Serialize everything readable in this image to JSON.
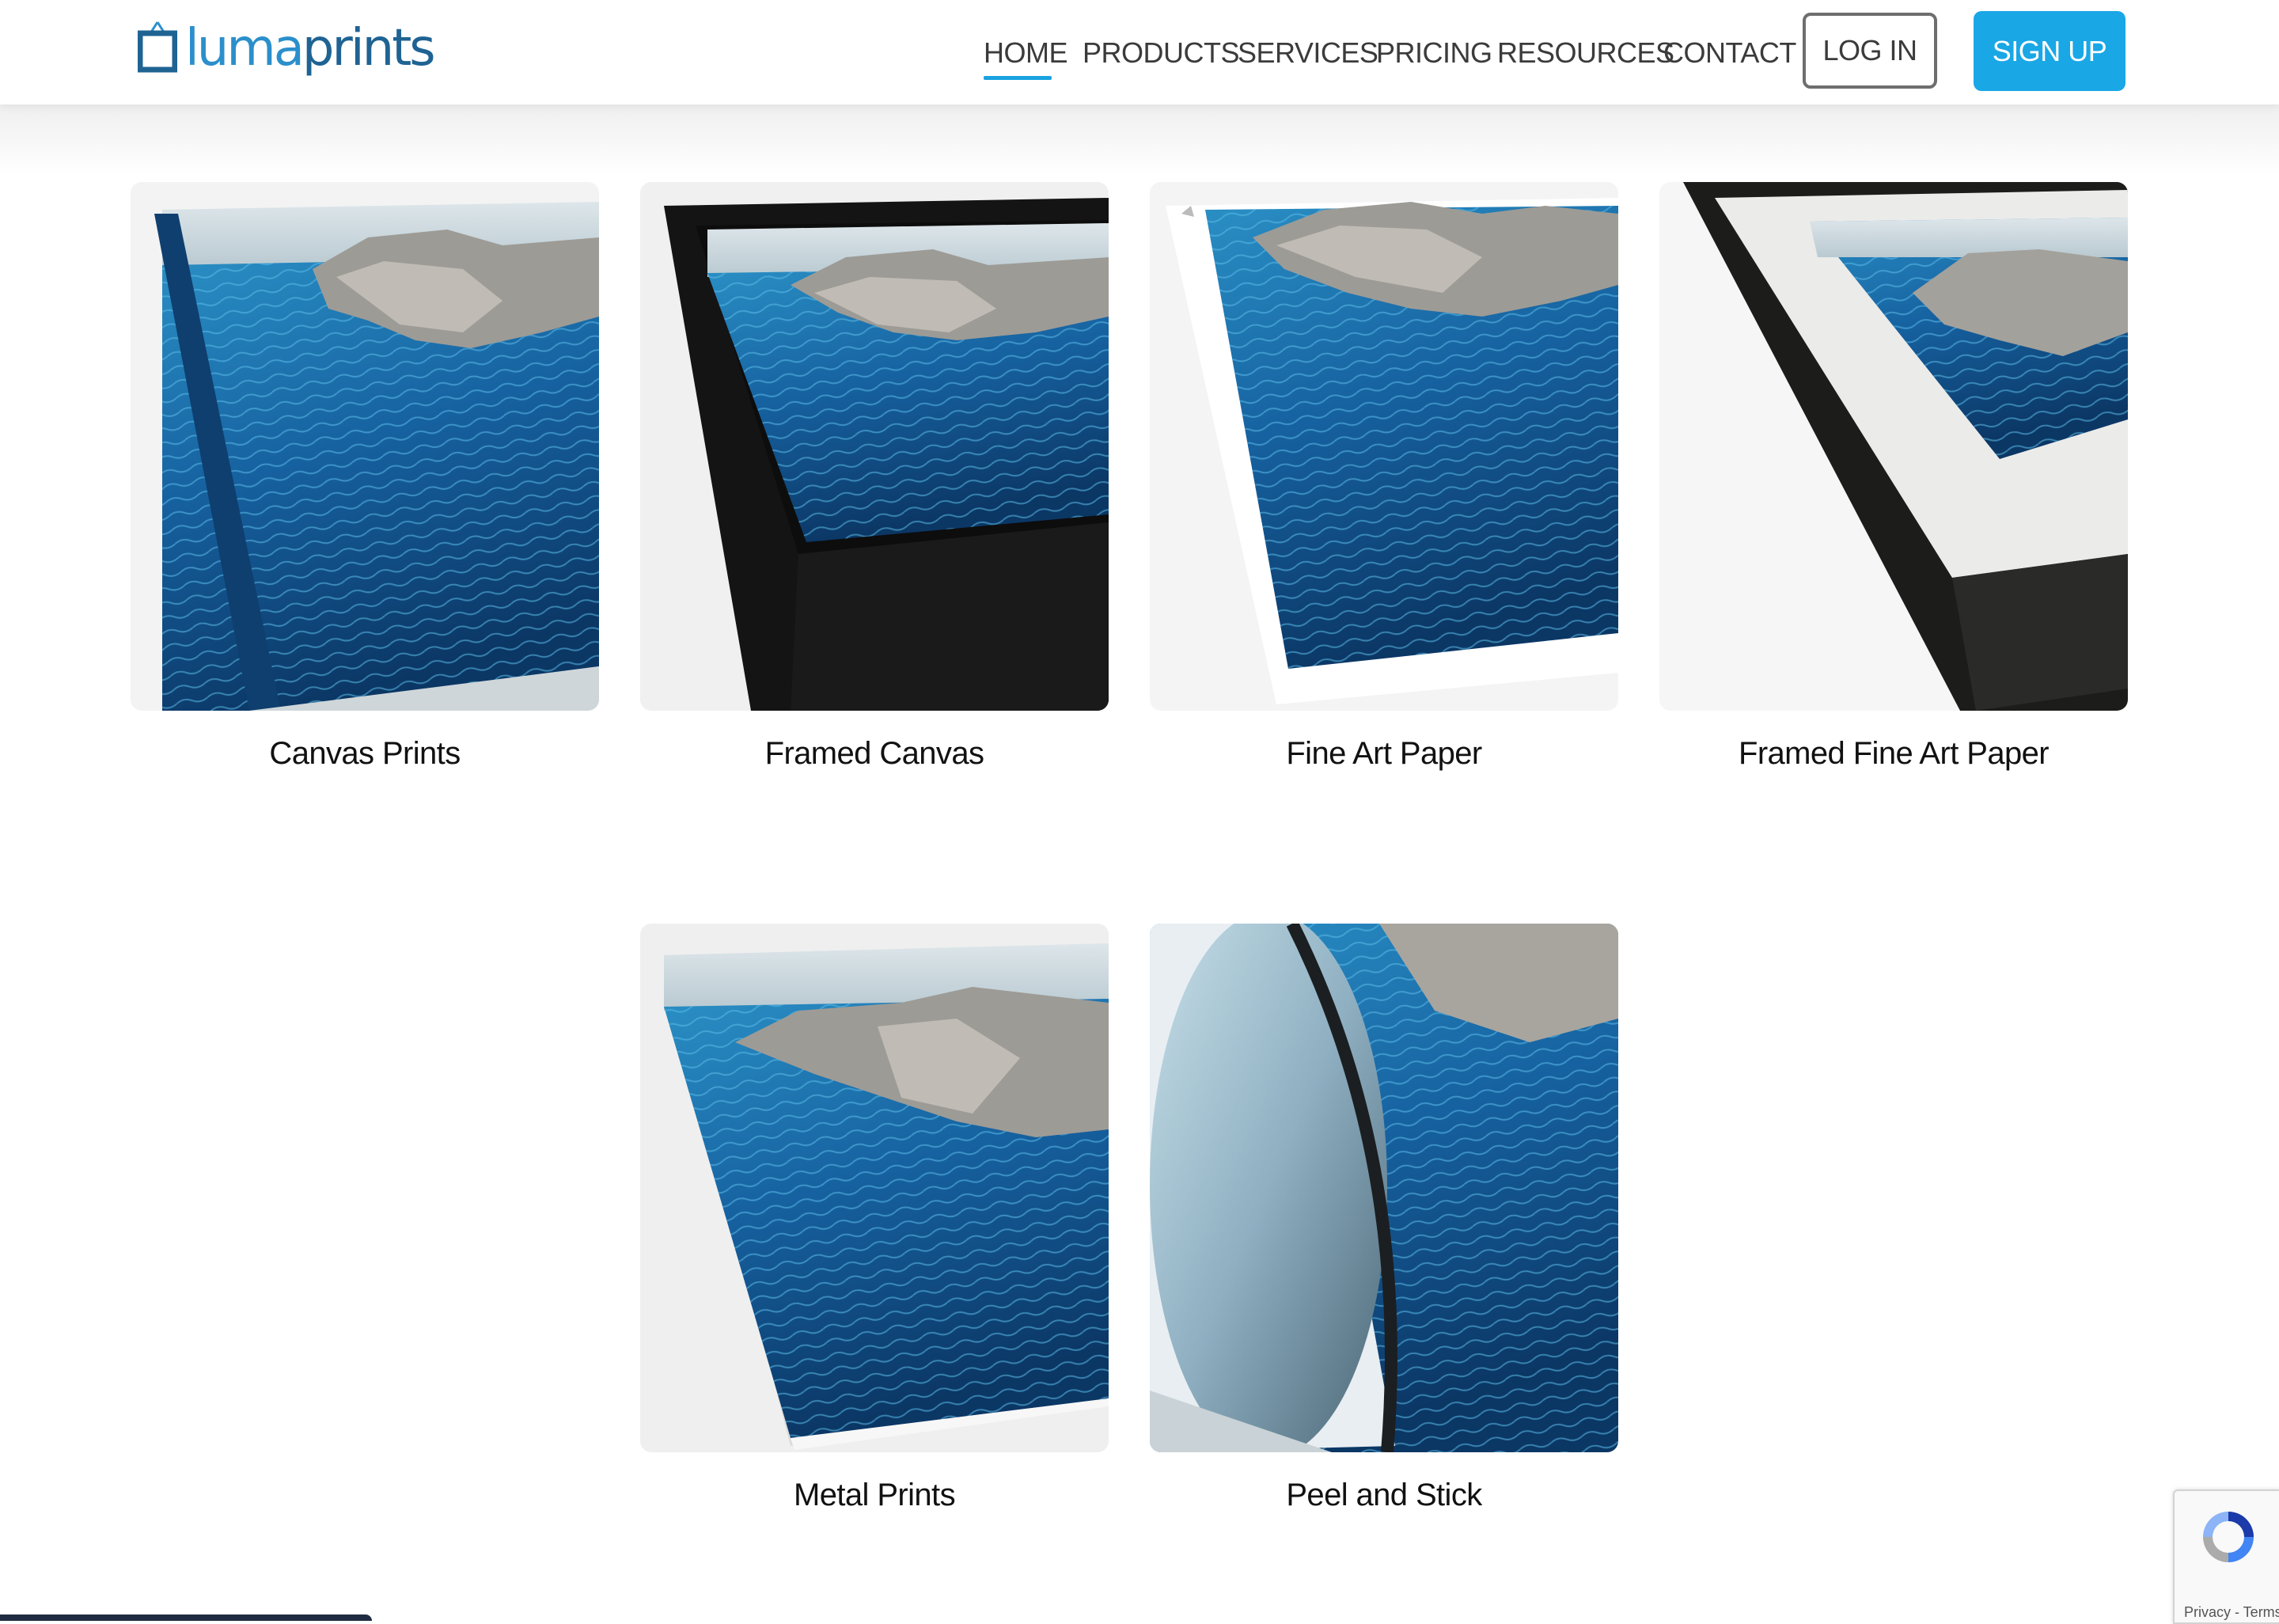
{
  "brand": {
    "name_part1": "luma",
    "name_part2": "prints",
    "color_primary": "#2b8fcb",
    "color_dark": "#1f6393"
  },
  "nav": {
    "items": [
      "HOME",
      "PRODUCTS",
      "SERVICES",
      "PRICING",
      "RESOURCES",
      "CONTACT"
    ],
    "active": "HOME",
    "login_label": "LOG IN",
    "signup_label": "SIGN UP",
    "accent_color": "#19a7e6"
  },
  "products": [
    {
      "name": "Canvas Prints",
      "icon": "canvas-print-image"
    },
    {
      "name": "Framed Canvas",
      "icon": "framed-canvas-image"
    },
    {
      "name": "Fine Art Paper",
      "icon": "fine-art-paper-image"
    },
    {
      "name": "Framed Fine Art Paper",
      "icon": "framed-fine-art-paper-image"
    },
    {
      "name": "Metal Prints",
      "icon": "metal-print-image"
    },
    {
      "name": "Peel and Stick",
      "icon": "peel-and-stick-image"
    }
  ],
  "recaptcha": {
    "links": "Privacy - Terms",
    "icon": "recaptcha-icon"
  }
}
